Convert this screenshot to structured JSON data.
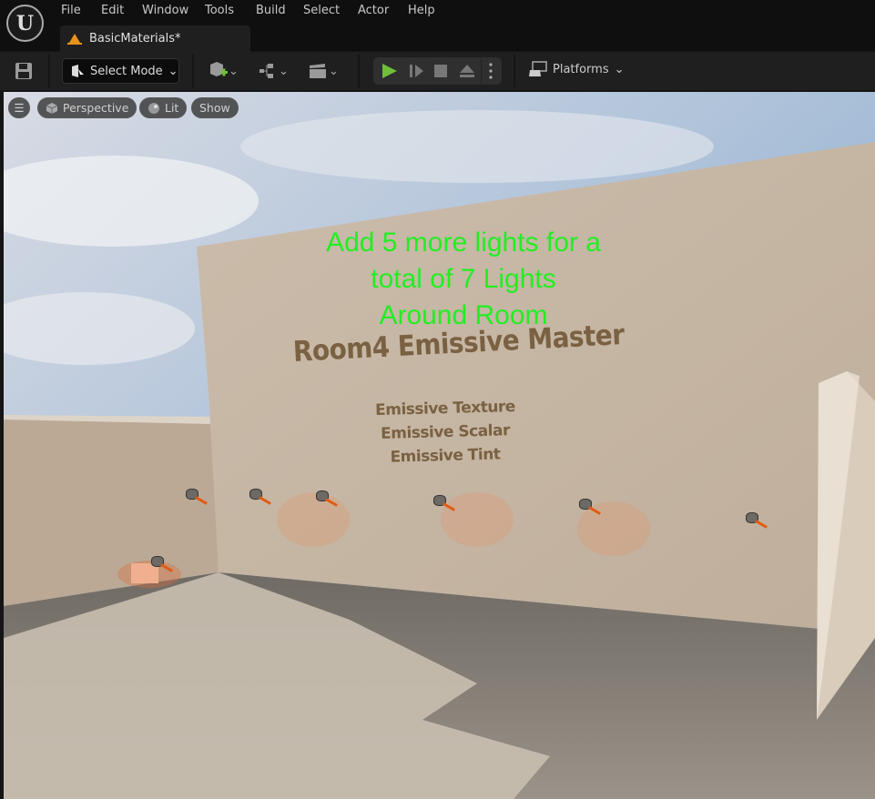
{
  "menu": [
    "File",
    "Edit",
    "Window",
    "Tools",
    "Build",
    "Select",
    "Actor",
    "Help"
  ],
  "tab": {
    "title": "BasicMaterials*"
  },
  "toolbar": {
    "select_mode": "Select Mode",
    "platforms": "Platforms"
  },
  "viewport": {
    "perspective": "Perspective",
    "lit": "Lit",
    "show": "Show"
  },
  "scene": {
    "instruction": [
      "Add 5 more lights for a",
      "total of 7 Lights",
      "Around Room"
    ],
    "title": "Room4 Emissive Master",
    "subs": [
      "Emissive Texture",
      "Emissive Scalar",
      "Emissive Tint"
    ]
  },
  "colors": {
    "instruction": "#22ee22",
    "play": "#6fbf3a",
    "accent": "#e8921e"
  }
}
